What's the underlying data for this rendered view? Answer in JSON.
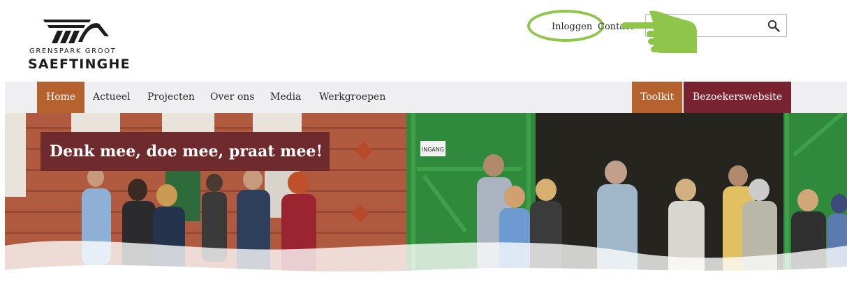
{
  "brand": {
    "line1": "GRENSPARK GROOT",
    "line2": "SAEFTINGHE"
  },
  "header": {
    "login_label": "Inloggen",
    "contact_label": "Contact",
    "search_placeholder": "",
    "search_icon": "search-icon",
    "annotation_color": "#8ec54a"
  },
  "nav": {
    "items": [
      {
        "label": "Home"
      },
      {
        "label": "Actueel"
      },
      {
        "label": "Projecten"
      },
      {
        "label": "Over ons"
      },
      {
        "label": "Media"
      },
      {
        "label": "Werkgroepen"
      }
    ],
    "toolkit_label": "Toolkit",
    "visitor_label": "Bezoekerswebsite",
    "colors": {
      "active": "#b5622f",
      "visitor": "#7a2330",
      "bar": "#efeef1"
    }
  },
  "hero": {
    "banner_text": "Denk mee, doe mee, praat mee!",
    "sign_text": "INGANG",
    "banner_color": "#6e2a2c"
  }
}
